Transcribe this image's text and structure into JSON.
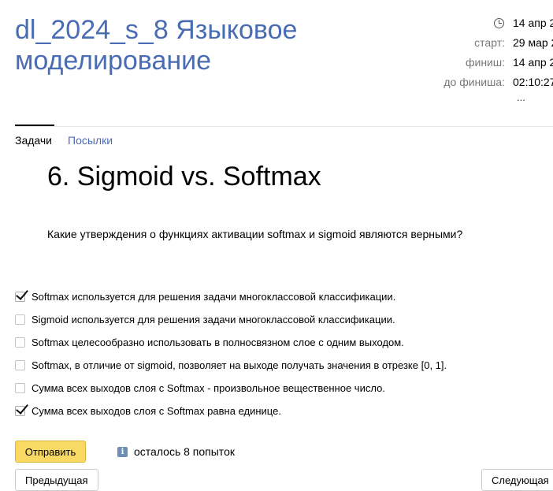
{
  "contest": {
    "title": "dl_2024_s_8 Языковое моделирование",
    "meta": {
      "current_time": "14 апр 2",
      "start_label": "старт:",
      "start_value": "29 мар 2",
      "finish_label": "финиш:",
      "finish_value": "14 апр 2",
      "remaining_label": "до финиша:",
      "remaining_value": "02:10:27",
      "more": "..."
    }
  },
  "tabs": {
    "problems": "Задачи",
    "submissions": "Посылки"
  },
  "problem": {
    "title": "6. Sigmoid vs. Softmax",
    "question": "Какие утверждения о функциях активации softmax и sigmoid являются верными?",
    "options": [
      {
        "label": "Softmax используется для решения задачи многоклассовой классификации.",
        "checked": true
      },
      {
        "label": "Sigmoid используется для решения задачи многоклассовой классификации.",
        "checked": false
      },
      {
        "label": "Softmax целесообразно использовать в полносвязном слое с одним выходом.",
        "checked": false
      },
      {
        "label": "Softmax, в отличие от sigmoid, позволяет на выходе получать значения в отрезке [0, 1].",
        "checked": false
      },
      {
        "label": "Сумма всех выходов слоя с Softmax - произвольное вещественное число.",
        "checked": false
      },
      {
        "label": "Сумма всех выходов слоя с Softmax равна единице.",
        "checked": true
      }
    ]
  },
  "actions": {
    "submit": "Отправить",
    "attempts_left": "осталось 8 попыток",
    "prev": "Предыдущая",
    "next": "Следующая"
  },
  "colors": {
    "link": "#4a6cb3",
    "submit_bg": "#f8d963"
  }
}
